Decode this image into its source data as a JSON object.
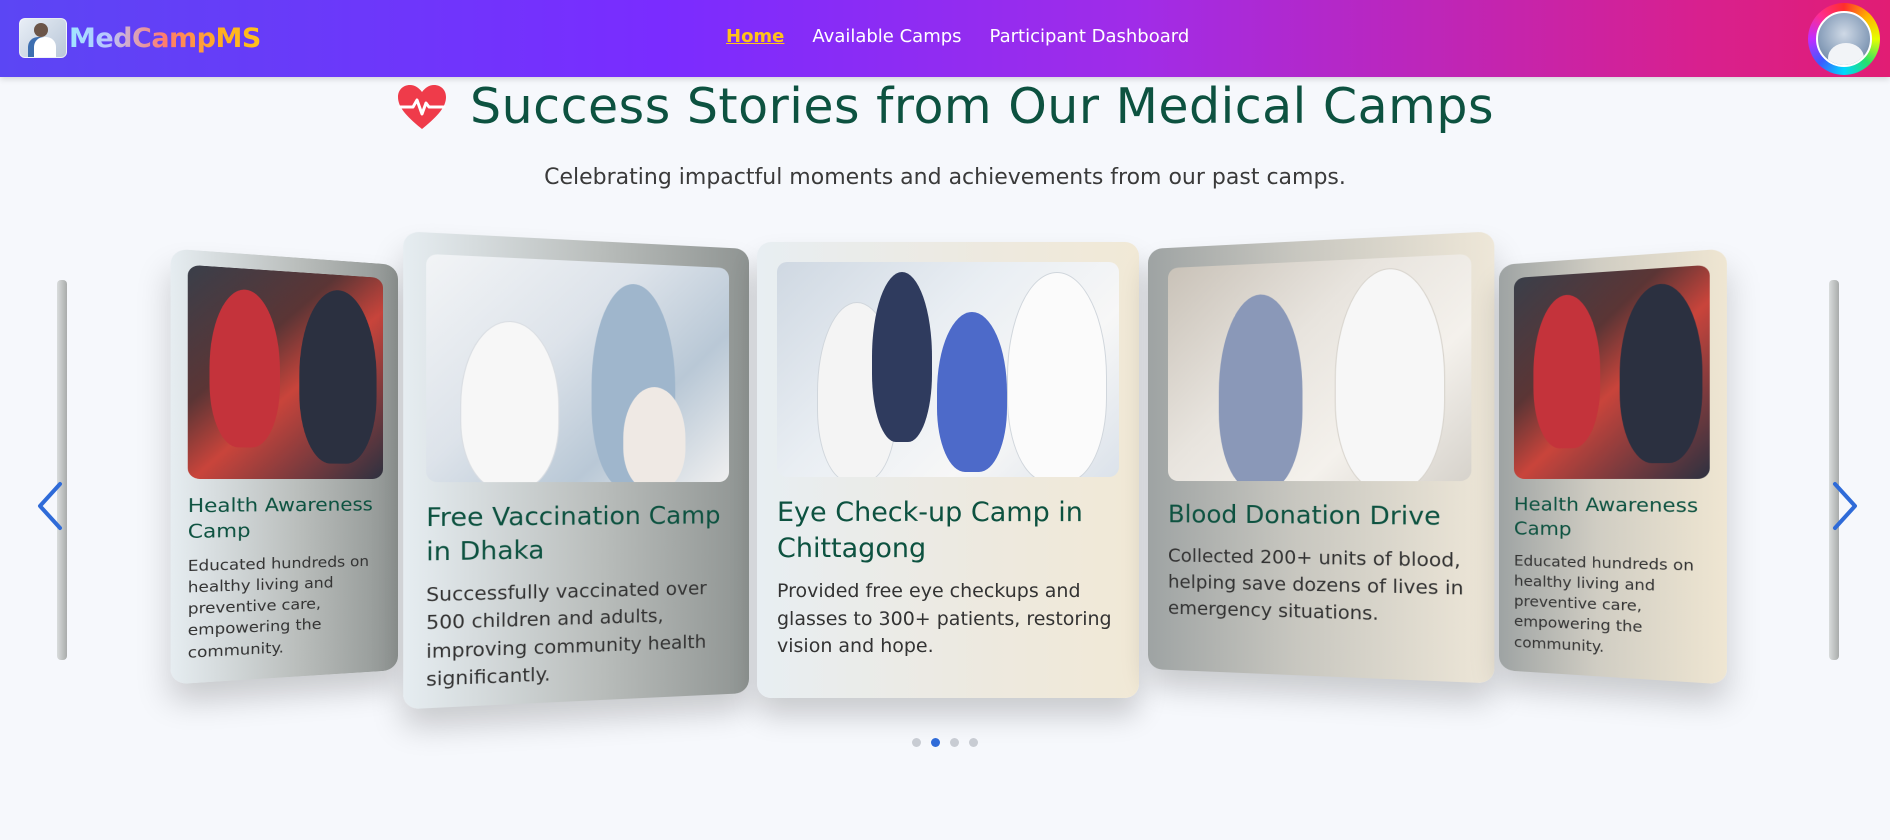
{
  "brand": {
    "name": "MedCampMS"
  },
  "nav": {
    "links": [
      "Home",
      "Available Camps",
      "Participant Dashboard"
    ]
  },
  "section": {
    "title": "Success Stories from Our Medical Camps",
    "subtitle": "Celebrating impactful moments and achievements from our past camps."
  },
  "stories": [
    {
      "title": "Health Awareness Camp",
      "text": "Educated hundreds on healthy living and preventive care, empowering the community."
    },
    {
      "title": "Free Vaccination Camp in Dhaka",
      "text": "Successfully vaccinated over 500 children and adults, improving community health significantly."
    },
    {
      "title": "Eye Check-up Camp in Chittagong",
      "text": "Provided free eye checkups and glasses to 300+ patients, restoring vision and hope."
    },
    {
      "title": "Blood Donation Drive",
      "text": "Collected 200+ units of blood, helping save dozens of lives in emergency situations."
    },
    {
      "title": "Health Awareness Camp",
      "text": "Educated hundreds on healthy living and preventive care, empowering the community."
    }
  ],
  "pagination": {
    "total": 4,
    "active": 2
  },
  "colors": {
    "accent": "#ffc21a",
    "title": "#0d5240",
    "heart": "#ef3b4a",
    "active_dot": "#2f6bd8"
  },
  "icons": {
    "heart": "heart-pulse-icon",
    "prev": "chevron-left-icon",
    "next": "chevron-right-icon"
  }
}
